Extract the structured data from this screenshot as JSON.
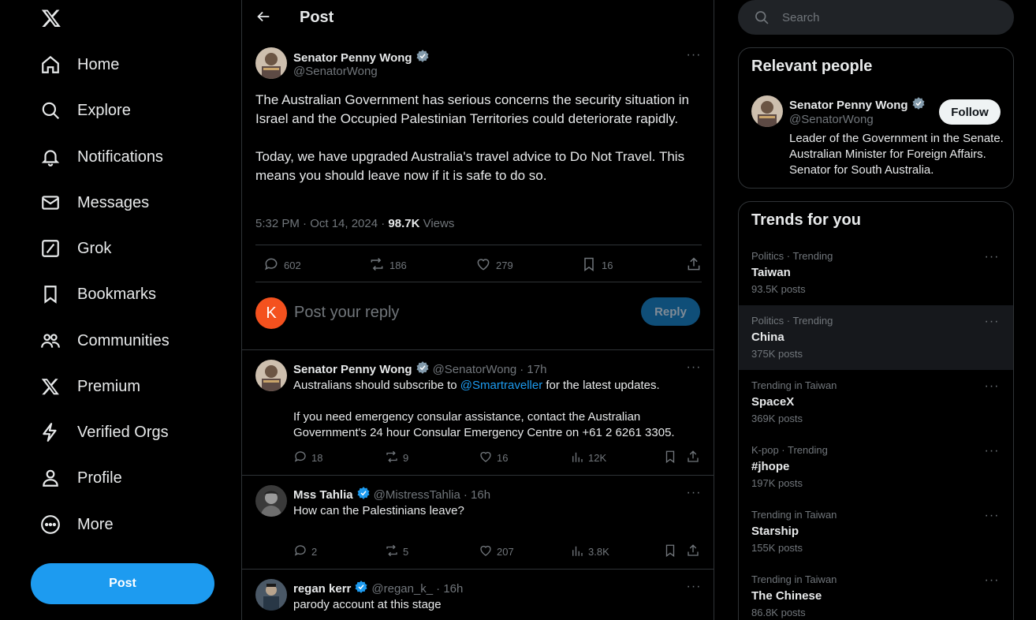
{
  "nav": {
    "items": [
      {
        "label": "Home",
        "icon": "home-icon"
      },
      {
        "label": "Explore",
        "icon": "search-icon"
      },
      {
        "label": "Notifications",
        "icon": "bell-icon"
      },
      {
        "label": "Messages",
        "icon": "envelope-icon"
      },
      {
        "label": "Grok",
        "icon": "grok-icon"
      },
      {
        "label": "Bookmarks",
        "icon": "bookmark-icon"
      },
      {
        "label": "Communities",
        "icon": "people-icon"
      },
      {
        "label": "Premium",
        "icon": "x-logo-icon"
      },
      {
        "label": "Verified Orgs",
        "icon": "lightning-icon"
      },
      {
        "label": "Profile",
        "icon": "person-icon"
      },
      {
        "label": "More",
        "icon": "more-circle-icon"
      }
    ],
    "post_label": "Post"
  },
  "header": {
    "title": "Post"
  },
  "main_tweet": {
    "name": "Senator Penny Wong",
    "handle": "@SenatorWong",
    "text": "The Australian Government has serious concerns the security situation in Israel and the Occupied Palestinian Territories could deteriorate rapidly.\n\nToday, we have upgraded Australia's travel advice to Do Not Travel. This means you should leave now if it is safe to do so.",
    "time": "5:32 PM · Oct 14, 2024 · ",
    "views_count": "98.7K",
    "views_label": " Views",
    "replies": "602",
    "reposts": "186",
    "likes": "279",
    "bookmarks": "16"
  },
  "reply_box": {
    "avatar_letter": "K",
    "placeholder": "Post your reply",
    "button": "Reply"
  },
  "replies": [
    {
      "name": "Senator Penny Wong",
      "handle": "@SenatorWong",
      "time": "· 17h",
      "text_pre": "Australians should subscribe to ",
      "link": "@Smartraveller",
      "text_post": " for the latest updates.\n\nIf you need emergency consular assistance, contact the Australian Government's 24 hour Consular Emergency Centre on +61 2 6261 3305.",
      "replies": "18",
      "reposts": "9",
      "likes": "16",
      "views": "12K"
    },
    {
      "name": "Mss Tahlia",
      "handle": "@MistressTahlia",
      "time": "· 16h",
      "text": "How can the Palestinians leave?",
      "replies": "2",
      "reposts": "5",
      "likes": "207",
      "views": "3.8K"
    },
    {
      "name": "regan kerr",
      "handle": "@regan_k_",
      "time": "· 16h",
      "text": "parody account at this stage"
    }
  ],
  "search": {
    "placeholder": "Search"
  },
  "relevant": {
    "title": "Relevant people",
    "name": "Senator Penny Wong",
    "handle": "@SenatorWong",
    "follow": "Follow",
    "bio": "Leader of the Government in the Senate. Australian Minister for Foreign Affairs. Senator for South Australia."
  },
  "trends": {
    "title": "Trends for you",
    "items": [
      {
        "category": "Politics · Trending",
        "topic": "Taiwan",
        "count": "93.5K posts"
      },
      {
        "category": "Politics · Trending",
        "topic": "China",
        "count": "375K posts"
      },
      {
        "category": "Trending in Taiwan",
        "topic": "SpaceX",
        "count": "369K posts"
      },
      {
        "category": "K-pop · Trending",
        "topic": "#jhope",
        "count": "197K posts"
      },
      {
        "category": "Trending in Taiwan",
        "topic": "Starship",
        "count": "155K posts"
      },
      {
        "category": "Trending in Taiwan",
        "topic": "The Chinese",
        "count": "86.8K posts"
      }
    ]
  },
  "colors": {
    "accent": "#1d9bf0",
    "gov_badge": "#829aab",
    "muted": "#71767b",
    "border": "#2f3336"
  }
}
